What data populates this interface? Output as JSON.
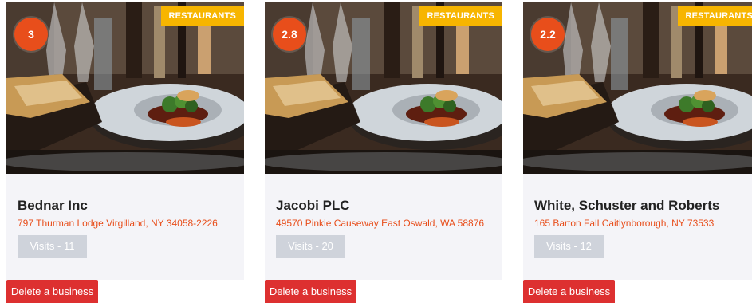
{
  "businesses": [
    {
      "category": "RESTAURANTS",
      "rating": "3",
      "name": "Bednar Inc",
      "address": "797 Thurman Lodge Virgilland, NY 34058-2226",
      "visits": "Visits - 11",
      "delete_label": "Delete a business",
      "image": "restaurant-table-photo"
    },
    {
      "category": "RESTAURANTS",
      "rating": "2.8",
      "name": "Jacobi PLC",
      "address": "49570 Pinkie Causeway East Oswald, WA 58876",
      "visits": "Visits - 20",
      "delete_label": "Delete a business",
      "image": "restaurant-table-photo"
    },
    {
      "category": "RESTAURANTS",
      "rating": "2.2",
      "name": "White, Schuster and Roberts",
      "address": "165 Barton Fall Caitlynborough, NY 73533",
      "visits": "Visits - 12",
      "delete_label": "Delete a business",
      "image": "restaurant-table-photo"
    }
  ],
  "colors": {
    "category_badge": "#f7b500",
    "rating_badge": "#e84e1b",
    "address_text": "#e84e1b",
    "visits_badge": "#cfd3db",
    "delete_button": "#dd3030",
    "card_background": "#f4f4f8"
  }
}
